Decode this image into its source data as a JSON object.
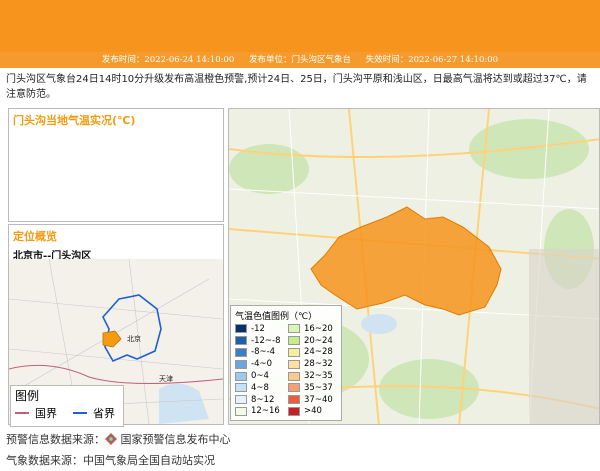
{
  "meta": {
    "publish_time": "发布时间：2022-06-24 14:10:00",
    "publisher": "发布单位：门头沟区气象台",
    "expire_time": "失效时间：2022-06-27 14:10:00"
  },
  "description": "门头沟区气象台24日14时10分升级发布高温橙色预警,预计24日、25日，门头沟平原和浅山区，日最高气温将达到或超过37℃，请注意防范。",
  "panels": {
    "temp_title": "门头沟当地气温实况(℃)",
    "location_title": "定位概览",
    "location_name": "北京市--门头沟区"
  },
  "locator_map": {
    "beijing_label": "北京",
    "tianjin_label": "天津",
    "legend_title": "图例",
    "country_border": "国界",
    "province_border": "省界",
    "colors": {
      "country": "#c0607a",
      "province": "#1f5fd6",
      "district": "#f39c12"
    }
  },
  "temp_legend": {
    "title": "气温色值图例（℃）",
    "items": [
      {
        "label": "-12",
        "color": "#08306b"
      },
      {
        "label": "16~20",
        "color": "#d9f7b0"
      },
      {
        "label": "-12~-8",
        "color": "#1d5fa8"
      },
      {
        "label": "20~24",
        "color": "#c4ee8c"
      },
      {
        "label": "-8~-4",
        "color": "#3a7fc6"
      },
      {
        "label": "24~28",
        "color": "#f3f09a"
      },
      {
        "label": "-4~0",
        "color": "#6aa6dc"
      },
      {
        "label": "28~32",
        "color": "#fbe0a0"
      },
      {
        "label": "0~4",
        "color": "#9cc9ee"
      },
      {
        "label": "32~35",
        "color": "#fbc98e"
      },
      {
        "label": "4~8",
        "color": "#c5e2f7"
      },
      {
        "label": "35~37",
        "color": "#f59f74"
      },
      {
        "label": "8~12",
        "color": "#e4f3fb"
      },
      {
        "label": "37~40",
        "color": "#ee5a3a"
      },
      {
        "label": "12~16",
        "color": "#f3fbe8"
      },
      {
        "label": ">40",
        "color": "#c81f1f"
      }
    ]
  },
  "warning_area_color": "#f7941d",
  "footer": {
    "warning_source": "预警信息数据来源：",
    "warning_org": "国家预警信息发布中心",
    "weather_source": "气象数据来源：中国气象局全国自动站实况"
  }
}
